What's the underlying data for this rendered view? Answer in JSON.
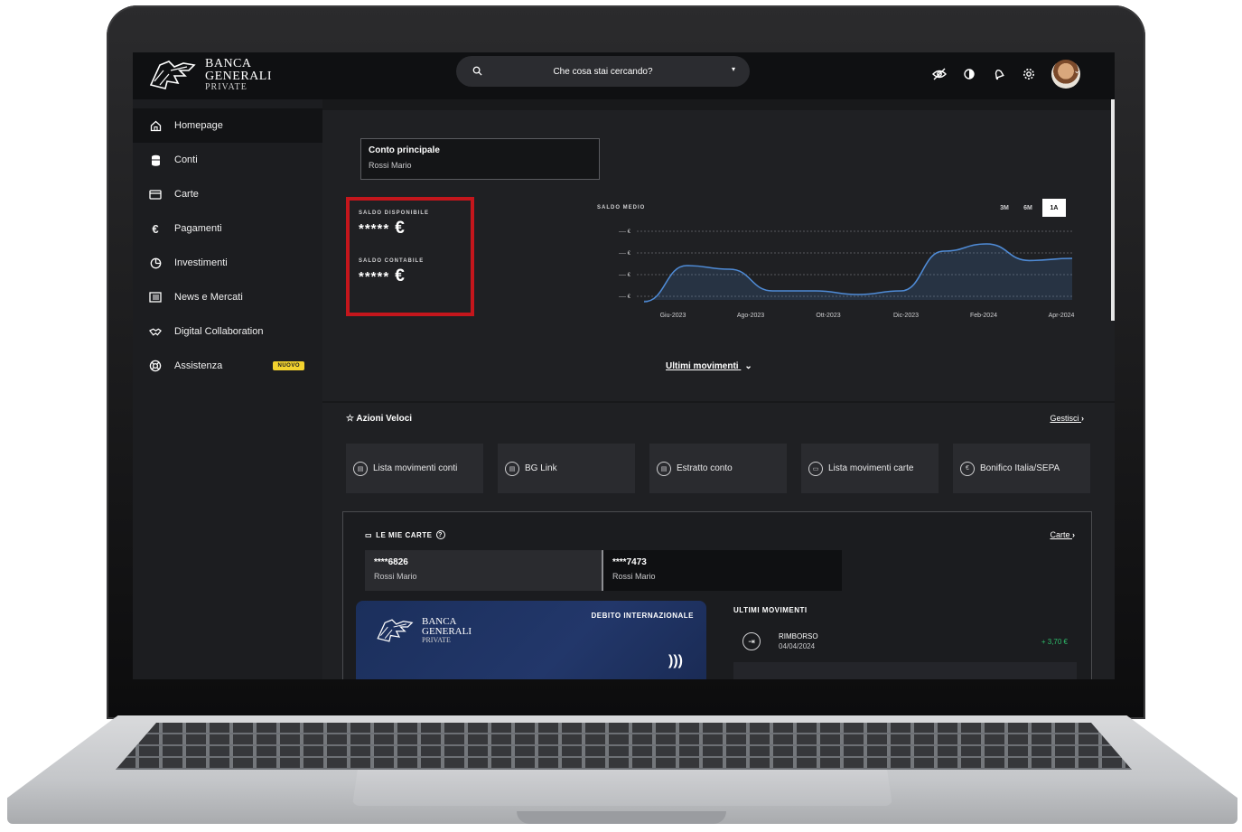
{
  "brand": {
    "line1": "BANCA",
    "line2": "GENERALI",
    "line3": "PRIVATE"
  },
  "search": {
    "placeholder": "Che cosa stai cercando?"
  },
  "top_icons": [
    "eye-slash-icon",
    "contrast-icon",
    "bell-icon",
    "gear-icon",
    "avatar"
  ],
  "sidebar": {
    "items": [
      {
        "label": "Homepage",
        "icon": "home-icon",
        "active": true
      },
      {
        "label": "Conti",
        "icon": "database-icon"
      },
      {
        "label": "Carte",
        "icon": "card-icon"
      },
      {
        "label": "Pagamenti",
        "icon": "euro-icon"
      },
      {
        "label": "Investimenti",
        "icon": "pie-icon"
      },
      {
        "label": "News e Mercati",
        "icon": "news-icon"
      },
      {
        "label": "Digital Collaboration",
        "icon": "handshake-icon"
      },
      {
        "label": "Assistenza",
        "icon": "lifebuoy-icon",
        "badge": "NUOVO"
      }
    ]
  },
  "account": {
    "title": "Conto principale",
    "owner": "Rossi Mario"
  },
  "balances": {
    "available_label": "SALDO DISPONIBILE",
    "available_value": "*****",
    "accounting_label": "SALDO CONTABILE",
    "accounting_value": "*****",
    "currency": "€"
  },
  "chart_data": {
    "type": "area",
    "title": "SALDO MEDIO",
    "x": [
      "Giu-2023",
      "Ago-2023",
      "Ott-2023",
      "Dic-2023",
      "Feb-2024",
      "Apr-2024"
    ],
    "y_ticks": [
      "---- €",
      "---- €",
      "---- €",
      "---- €"
    ],
    "series_shape": [
      0.05,
      0.55,
      0.5,
      0.2,
      0.2,
      0.15,
      0.2,
      0.75,
      0.85,
      0.62,
      0.65
    ],
    "range_options": [
      "3M",
      "6M",
      "1A"
    ],
    "selected_range": "1A",
    "grid": true,
    "color": "#4f8bd6"
  },
  "last_movements_link": "Ultimi movimenti",
  "quick_actions": {
    "title": "Azioni Veloci",
    "manage": "Gestisci",
    "items": [
      {
        "label": "Lista movimenti conti",
        "icon": "account-icon"
      },
      {
        "label": "BG Link",
        "icon": "link-icon"
      },
      {
        "label": "Estratto conto",
        "icon": "document-icon"
      },
      {
        "label": "Lista movimenti carte",
        "icon": "card-icon"
      },
      {
        "label": "Bonifico Italia/SEPA",
        "icon": "euro-icon"
      }
    ]
  },
  "cards": {
    "title": "LE MIE CARTE",
    "link": "Carte",
    "tabs": [
      {
        "number": "****6826",
        "owner": "Rossi Mario",
        "selected": true
      },
      {
        "number": "****7473",
        "owner": "Rossi Mario"
      }
    ],
    "card_kind": "DEBITO INTERNAZIONALE",
    "movements_title": "ULTIMI MOVIMENTI",
    "movements": [
      {
        "desc": "RIMBORSO",
        "date": "04/04/2024",
        "amount": "+ 3,70 €"
      }
    ]
  },
  "colors": {
    "accent_red": "#c4161c",
    "badge_yellow": "#f2d22e",
    "positive": "#2ebd6b",
    "chart_line": "#4f8bd6"
  }
}
